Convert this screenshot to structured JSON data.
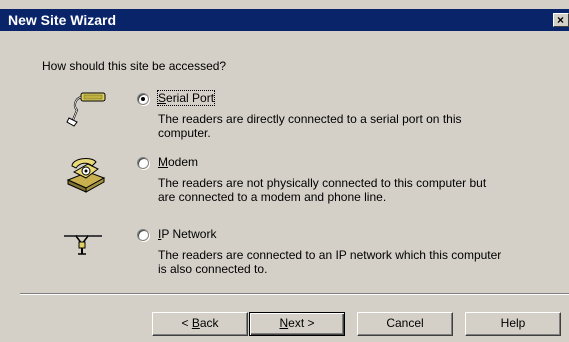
{
  "window": {
    "title": "New Site Wizard",
    "close_glyph": "×"
  },
  "question": "How should this site be accessed?",
  "options": [
    {
      "label_access": "S",
      "label_rest": "erial Port",
      "selected": true,
      "icon": "serial-cable-icon",
      "desc1": "The readers are directly connected to a serial port on this",
      "desc2": "computer."
    },
    {
      "label_access": "M",
      "label_rest": "odem",
      "selected": false,
      "icon": "modem-telephone-icon",
      "desc1": "The readers are not physically connected to this computer but",
      "desc2": "are connected to a modem and phone line."
    },
    {
      "label_access": "I",
      "label_rest": "P Network",
      "selected": false,
      "icon": "network-connector-icon",
      "desc1": "The readers are connected to an IP network which this computer",
      "desc2": "is also connected to."
    }
  ],
  "buttons": {
    "back": {
      "pre": "< ",
      "access": "B",
      "post": "ack"
    },
    "next": {
      "access": "N",
      "post": "ext >"
    },
    "cancel": "Cancel",
    "help": "Help"
  },
  "colors": {
    "titlebar": "#0a246a",
    "face": "#d4d0c8"
  }
}
